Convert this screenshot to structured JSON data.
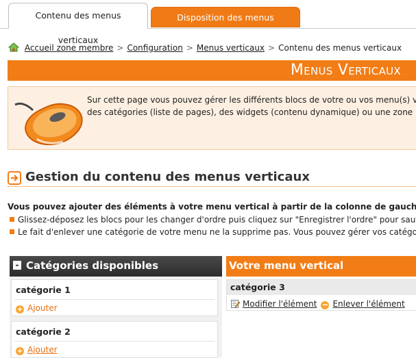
{
  "tabs": [
    {
      "label": "Contenu des menus verticaux",
      "active": true
    },
    {
      "label": "Disposition des menus verticaux",
      "active": false
    }
  ],
  "breadcrumb": {
    "home_icon": "home-icon",
    "items": [
      "Accueil zone membre",
      "Configuration",
      "Menus verticaux"
    ],
    "current": "Contenu des menus verticaux",
    "separator": ">"
  },
  "header": {
    "title": "Menus Verticaux"
  },
  "info": {
    "line1": "Sur cette page vous pouvez gérer les différents blocs de votre ou vos menu(s) ver",
    "line2": "des catégories (liste de pages), des widgets (contenu dynamique) ou une zone libr"
  },
  "section": {
    "title": "Gestion du contenu des menus verticaux"
  },
  "instructions": {
    "intro": "Vous pouvez ajouter des éléments à votre menu vertical à partir de la colonne de gauche :",
    "bullets": [
      "Glissez-déposez les blocs pour les changer d'ordre puis cliquez sur \"Enregistrer l'ordre\" pour sauvega",
      "Le fait d'enlever une catégorie de votre menu ne la supprime pas. Vous pouvez gérer vos catégorie"
    ]
  },
  "left_panel": {
    "title": "Catégories disponibles",
    "collapse_symbol": "-",
    "categories": [
      {
        "name": "catégorie 1",
        "add_label": "Ajouter"
      },
      {
        "name": "catégorie 2",
        "add_label": "Ajouter"
      }
    ]
  },
  "right_panel": {
    "title": "Votre menu vertical",
    "items": [
      {
        "name": "catégorie 3",
        "edit_label": "Modifier l'élément",
        "remove_label": "Enlever l'élément"
      }
    ]
  },
  "colors": {
    "accent": "#f27d16",
    "dark_header": "#333333",
    "info_bg": "#fdf0e2"
  }
}
